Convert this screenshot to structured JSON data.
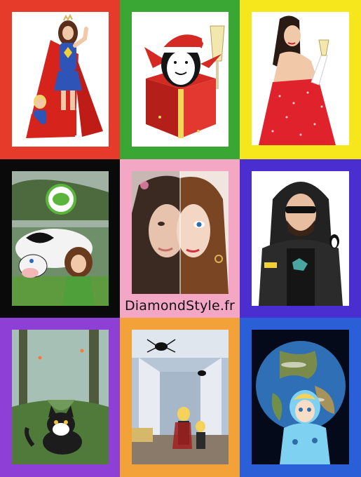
{
  "grid": {
    "tiles": [
      {
        "name": "superhero-mother-and-child",
        "frame_color": "#e63a2a"
      },
      {
        "name": "christmas-gift-box-penguin",
        "frame_color": "#3aa634"
      },
      {
        "name": "woman-red-dress-champagne",
        "frame_color": "#f6e61c"
      },
      {
        "name": "vegan-cow-hug",
        "frame_color": "#0a0a0a"
      },
      {
        "name": "half-photo-half-drawing-portrait",
        "frame_color": "#f4a7c4",
        "caption": "DiamondStyle.fr"
      },
      {
        "name": "bearded-man-sunglasses",
        "frame_color": "#4b2ed0"
      },
      {
        "name": "kitten-in-forest",
        "frame_color": "#8e3fd6"
      },
      {
        "name": "halloween-children-spiders",
        "frame_color": "#f3a23a"
      },
      {
        "name": "baby-on-earth",
        "frame_color": "#2a5fd8"
      }
    ]
  }
}
